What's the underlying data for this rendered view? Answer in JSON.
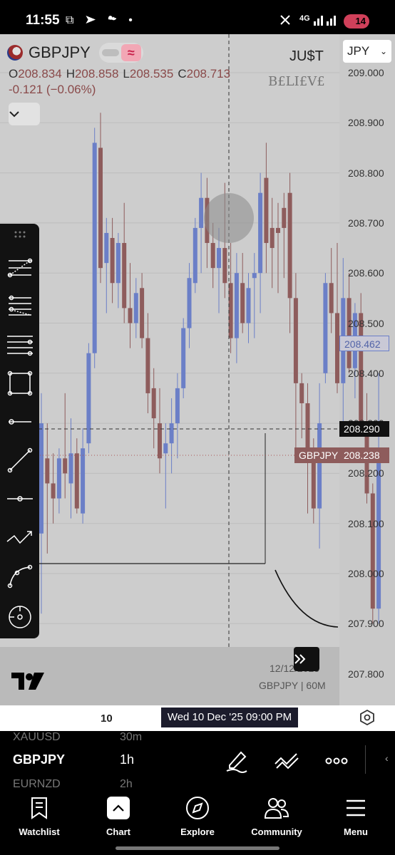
{
  "status": {
    "time": "11:55",
    "icons": "⧉ ➤ ☁ •",
    "network": "4G",
    "battery": "14"
  },
  "header": {
    "symbol": "GBPJPY",
    "open_label": "O",
    "open": "208.834",
    "high_label": "H",
    "high": "208.858",
    "low_label": "L",
    "low": "208.535",
    "close_label": "C",
    "close": "208.713",
    "change": "-0.121 (−0.06%)",
    "brand_line1": "JU$T",
    "brand_line2": "B£LI£V£",
    "currency": "JPY",
    "wave_icon": "≈"
  },
  "price_axis": [
    "209.000",
    "208.900",
    "208.800",
    "208.700",
    "208.600",
    "208.500",
    "208.400",
    "208.300",
    "208.200",
    "208.100",
    "208.000",
    "207.900",
    "207.800"
  ],
  "tags": {
    "current_price": "208.462",
    "crosshair_price": "208.290",
    "last_symbol": "GBPJPY",
    "last_price": "208.238"
  },
  "watermark": {
    "date": "12/12/2025",
    "interval": "GBPJPY | 60M"
  },
  "time_axis": {
    "tick": "10",
    "cursor_label": "Wed 10 Dec '25   09:00 PM"
  },
  "watchlist_panel": {
    "prev_symbol": "XAUUSD",
    "prev_tf": "30m",
    "symbol": "GBPJPY",
    "tf": "1h",
    "next_symbol": "EURNZD",
    "next_tf": "2h"
  },
  "nav": [
    {
      "label": "Watchlist",
      "icon": "bookmark-icon"
    },
    {
      "label": "Chart",
      "icon": "chart-icon"
    },
    {
      "label": "Explore",
      "icon": "compass-icon"
    },
    {
      "label": "Community",
      "icon": "people-icon"
    },
    {
      "label": "Menu",
      "icon": "hamburger-icon"
    }
  ],
  "colors": {
    "bull": "#6b7fc7",
    "bear": "#8e5c5c",
    "chart_bg": "#cdcdcd"
  },
  "chart_data": {
    "type": "candlestick",
    "ylim": [
      207.75,
      209.03
    ],
    "price_ticks": [
      209.0,
      208.9,
      208.8,
      208.7,
      208.6,
      208.5,
      208.4,
      208.3,
      208.2,
      208.1,
      208.0,
      207.9,
      207.8
    ],
    "candles": [
      {
        "o": 208.08,
        "h": 208.36,
        "l": 207.92,
        "c": 208.3
      },
      {
        "o": 208.23,
        "h": 208.3,
        "l": 208.04,
        "c": 208.18
      },
      {
        "o": 208.18,
        "h": 208.24,
        "l": 208.1,
        "c": 208.15
      },
      {
        "o": 208.15,
        "h": 208.25,
        "l": 208.12,
        "c": 208.23
      },
      {
        "o": 208.23,
        "h": 208.36,
        "l": 208.15,
        "c": 208.2
      },
      {
        "o": 208.18,
        "h": 208.31,
        "l": 208.11,
        "c": 208.24
      },
      {
        "o": 208.24,
        "h": 208.27,
        "l": 208.12,
        "c": 208.13
      },
      {
        "o": 208.12,
        "h": 208.29,
        "l": 208.1,
        "c": 208.25
      },
      {
        "o": 208.26,
        "h": 208.46,
        "l": 208.24,
        "c": 208.44
      },
      {
        "o": 208.44,
        "h": 208.89,
        "l": 208.41,
        "c": 208.86
      },
      {
        "o": 208.85,
        "h": 208.92,
        "l": 208.58,
        "c": 208.61
      },
      {
        "o": 208.62,
        "h": 208.71,
        "l": 208.52,
        "c": 208.68
      },
      {
        "o": 208.67,
        "h": 208.71,
        "l": 208.54,
        "c": 208.58
      },
      {
        "o": 208.58,
        "h": 208.68,
        "l": 208.53,
        "c": 208.66
      },
      {
        "o": 208.66,
        "h": 208.74,
        "l": 208.5,
        "c": 208.53
      },
      {
        "o": 208.53,
        "h": 208.62,
        "l": 208.45,
        "c": 208.5
      },
      {
        "o": 208.5,
        "h": 208.59,
        "l": 208.47,
        "c": 208.56
      },
      {
        "o": 208.57,
        "h": 208.6,
        "l": 208.45,
        "c": 208.47
      },
      {
        "o": 208.47,
        "h": 208.52,
        "l": 208.32,
        "c": 208.36
      },
      {
        "o": 208.37,
        "h": 208.41,
        "l": 208.25,
        "c": 208.31
      },
      {
        "o": 208.3,
        "h": 208.37,
        "l": 208.2,
        "c": 208.23
      },
      {
        "o": 208.24,
        "h": 208.3,
        "l": 208.13,
        "c": 208.26
      },
      {
        "o": 208.26,
        "h": 208.35,
        "l": 208.2,
        "c": 208.3
      },
      {
        "o": 208.3,
        "h": 208.4,
        "l": 208.23,
        "c": 208.37
      },
      {
        "o": 208.37,
        "h": 208.51,
        "l": 208.35,
        "c": 208.49
      },
      {
        "o": 208.49,
        "h": 208.62,
        "l": 208.45,
        "c": 208.59
      },
      {
        "o": 208.58,
        "h": 208.71,
        "l": 208.56,
        "c": 208.69
      },
      {
        "o": 208.69,
        "h": 208.8,
        "l": 208.6,
        "c": 208.75
      },
      {
        "o": 208.75,
        "h": 208.79,
        "l": 208.61,
        "c": 208.66
      },
      {
        "o": 208.66,
        "h": 208.7,
        "l": 208.57,
        "c": 208.61
      },
      {
        "o": 208.61,
        "h": 208.69,
        "l": 208.52,
        "c": 208.65
      },
      {
        "o": 208.65,
        "h": 208.78,
        "l": 208.55,
        "c": 208.58
      },
      {
        "o": 208.58,
        "h": 208.66,
        "l": 208.44,
        "c": 208.47
      },
      {
        "o": 208.47,
        "h": 208.64,
        "l": 208.42,
        "c": 208.6
      },
      {
        "o": 208.58,
        "h": 208.64,
        "l": 208.48,
        "c": 208.5
      },
      {
        "o": 208.5,
        "h": 208.6,
        "l": 208.46,
        "c": 208.57
      },
      {
        "o": 208.59,
        "h": 208.64,
        "l": 208.47,
        "c": 208.6
      },
      {
        "o": 208.6,
        "h": 208.8,
        "l": 208.52,
        "c": 208.76
      },
      {
        "o": 208.79,
        "h": 208.86,
        "l": 208.6,
        "c": 208.66
      },
      {
        "o": 208.69,
        "h": 208.75,
        "l": 208.57,
        "c": 208.65
      },
      {
        "o": 208.69,
        "h": 208.74,
        "l": 208.56,
        "c": 208.68
      },
      {
        "o": 208.73,
        "h": 208.76,
        "l": 208.59,
        "c": 208.69
      },
      {
        "o": 208.76,
        "h": 208.8,
        "l": 208.48,
        "c": 208.55
      },
      {
        "o": 208.55,
        "h": 208.6,
        "l": 208.24,
        "c": 208.38
      },
      {
        "o": 208.38,
        "h": 208.4,
        "l": 208.27,
        "c": 208.34
      },
      {
        "o": 208.34,
        "h": 208.38,
        "l": 208.12,
        "c": 208.23
      },
      {
        "o": 208.23,
        "h": 208.27,
        "l": 208.1,
        "c": 208.13
      },
      {
        "o": 208.13,
        "h": 208.38,
        "l": 208.05,
        "c": 208.3
      },
      {
        "o": 208.4,
        "h": 208.6,
        "l": 208.38,
        "c": 208.58
      },
      {
        "o": 208.58,
        "h": 208.65,
        "l": 208.48,
        "c": 208.52
      },
      {
        "o": 208.52,
        "h": 208.66,
        "l": 208.36,
        "c": 208.38
      },
      {
        "o": 208.38,
        "h": 208.63,
        "l": 208.3,
        "c": 208.55
      },
      {
        "o": 208.55,
        "h": 208.6,
        "l": 208.4,
        "c": 208.41
      },
      {
        "o": 208.41,
        "h": 208.54,
        "l": 208.35,
        "c": 208.52
      },
      {
        "o": 208.52,
        "h": 208.56,
        "l": 208.28,
        "c": 208.29
      },
      {
        "o": 208.29,
        "h": 208.36,
        "l": 208.14,
        "c": 208.16
      },
      {
        "o": 208.16,
        "h": 208.18,
        "l": 207.9,
        "c": 207.93
      },
      {
        "o": 207.93,
        "h": 208.4,
        "l": 207.9,
        "c": 208.23
      }
    ]
  }
}
